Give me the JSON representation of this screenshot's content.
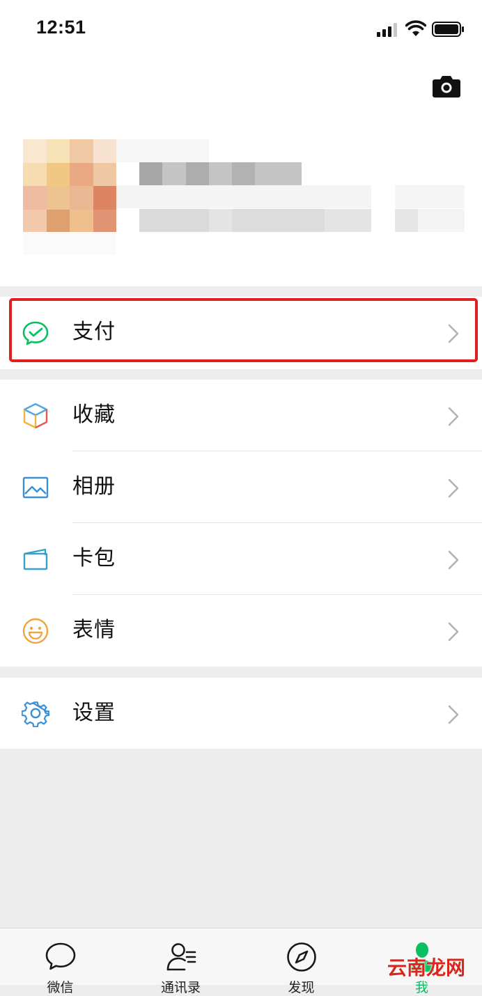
{
  "status_bar": {
    "time": "12:51"
  },
  "menu": {
    "pay": "支付",
    "favorites": "收藏",
    "album": "相册",
    "cards": "卡包",
    "stickers": "表情",
    "settings": "设置"
  },
  "tabs": [
    "微信",
    "通讯录",
    "发现",
    "我"
  ],
  "watermark": "云南龙网",
  "colors": {
    "accent": "#07c160",
    "highlight": "#e02020",
    "background": "#ededed"
  },
  "icons": {
    "profile": "camera-icon",
    "menu": [
      "wechat-pay-icon",
      "favorites-cube-icon",
      "album-image-icon",
      "card-wallet-icon",
      "emoji-smile-icon",
      "settings-gear-icon"
    ],
    "tabs": [
      "chat-bubble-icon",
      "contacts-icon",
      "discover-compass-icon",
      "me-person-icon"
    ]
  }
}
